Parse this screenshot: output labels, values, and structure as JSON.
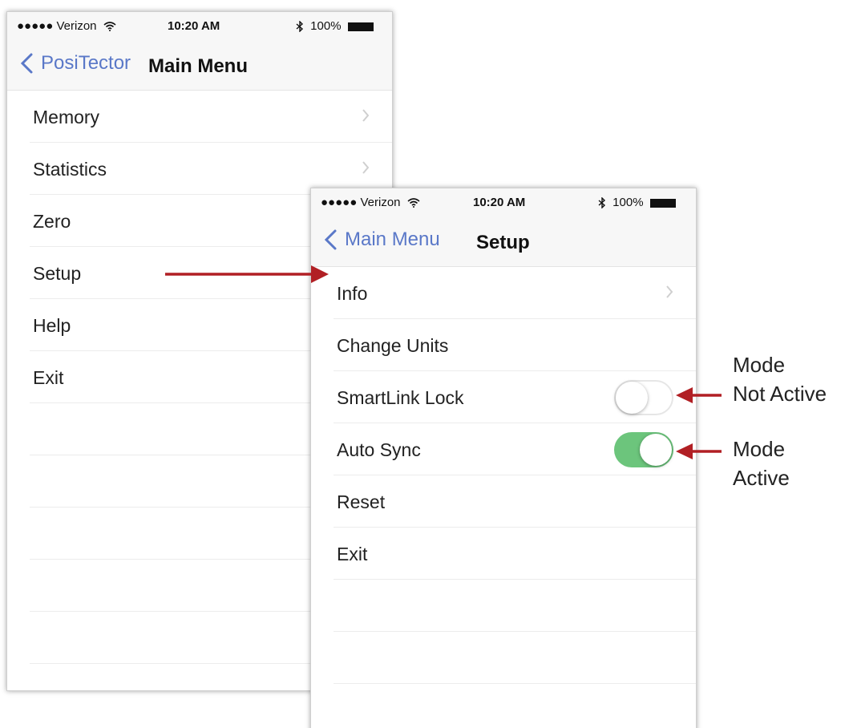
{
  "main_phone": {
    "status": {
      "carrier": "●●●●● Verizon",
      "wifi": "wifi-icon",
      "time": "10:20 AM",
      "bluetooth": "bluetooth-icon",
      "battery": "100%"
    },
    "nav": {
      "back_label": "PosiTector",
      "title": "Main Menu"
    },
    "items": [
      {
        "label": "Memory"
      },
      {
        "label": "Statistics"
      },
      {
        "label": "Zero"
      },
      {
        "label": "Setup"
      },
      {
        "label": "Help"
      },
      {
        "label": "Exit"
      }
    ]
  },
  "setup_phone": {
    "status": {
      "carrier": "●●●●● Verizon",
      "wifi": "wifi-icon",
      "time": "10:20 AM",
      "bluetooth": "bluetooth-icon",
      "battery": "100%"
    },
    "nav": {
      "back_label": "Main Menu",
      "title": "Setup"
    },
    "items": [
      {
        "label": "Info"
      },
      {
        "label": "Change Units"
      },
      {
        "label": "SmartLink Lock",
        "toggle": false
      },
      {
        "label": "Auto Sync",
        "toggle": true
      },
      {
        "label": "Reset"
      },
      {
        "label": "Exit"
      }
    ]
  },
  "annotations": {
    "not_active_line1": "Mode",
    "not_active_line2": "Not Active",
    "active_line1": "Mode",
    "active_line2": "Active"
  },
  "colors": {
    "accent": "#5a78c8",
    "toggle_on": "#6cc57c",
    "arrow": "#b11f24"
  }
}
